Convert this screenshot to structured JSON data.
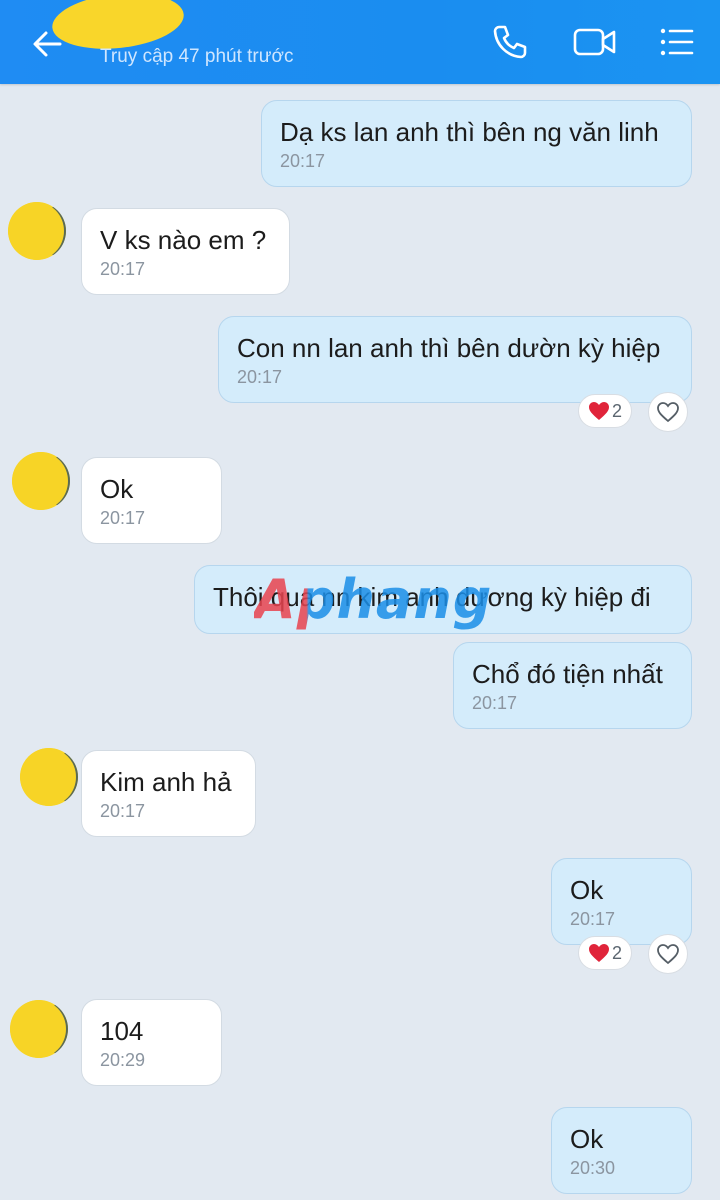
{
  "header": {
    "last_seen": "Truy cập 47 phút trước",
    "icons": [
      "back-arrow-icon",
      "phone-icon",
      "video-call-icon",
      "menu-icon"
    ]
  },
  "messages": [
    {
      "dir": "out",
      "text": "Dạ ks lan anh thì bên ng văn linh",
      "time": "20:17"
    },
    {
      "dir": "in",
      "text": "V ks nào em ?",
      "time": "20:17"
    },
    {
      "dir": "out",
      "text": "Con nn lan anh thì bên dườn kỳ hiệp",
      "time": "20:17",
      "reactions": {
        "emoji": "heart",
        "count": "2"
      }
    },
    {
      "dir": "in",
      "text": "Ok",
      "time": "20:17"
    },
    {
      "dir": "out",
      "text": "Thôi qua nn kim anh dương kỳ hiệp đi",
      "time": ""
    },
    {
      "dir": "out",
      "text": "Chổ đó tiện nhất",
      "time": "20:17"
    },
    {
      "dir": "in",
      "text": "Kim anh hả",
      "time": "20:17"
    },
    {
      "dir": "out",
      "text": "Ok",
      "time": "20:17",
      "reactions": {
        "emoji": "heart",
        "count": "2"
      }
    },
    {
      "dir": "in",
      "text": "104",
      "time": "20:29"
    },
    {
      "dir": "out",
      "text": "Ok",
      "time": "20:30"
    }
  ],
  "watermark": "Aphang",
  "colors": {
    "header": "#1f8cf3",
    "background": "#e2e9f1",
    "outgoing_bubble": "#d4ecfb",
    "incoming_bubble": "#ffffff",
    "heart": "#e0243a",
    "avatar_redaction": "#f7d426"
  }
}
